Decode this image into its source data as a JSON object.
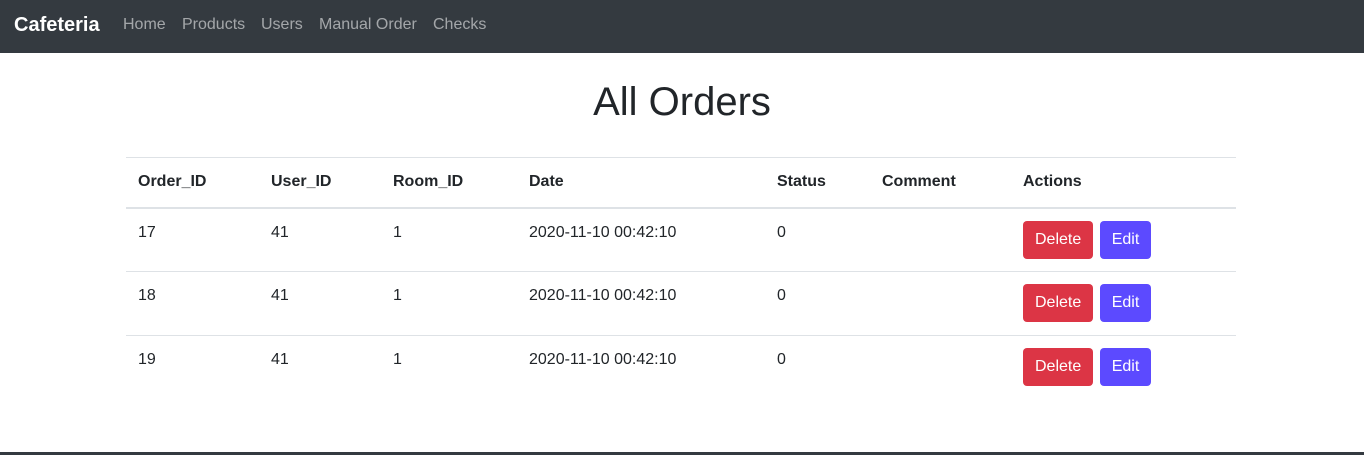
{
  "navbar": {
    "brand": "Cafeteria",
    "links": [
      "Home",
      "Products",
      "Users",
      "Manual Order",
      "Checks"
    ]
  },
  "page": {
    "title": "All Orders"
  },
  "table": {
    "columns": [
      "Order_ID",
      "User_ID",
      "Room_ID",
      "Date",
      "Status",
      "Comment",
      "Actions"
    ],
    "rows": [
      {
        "order_id": "17",
        "user_id": "41",
        "room_id": "1",
        "date": "2020-11-10 00:42:10",
        "status": "0",
        "comment": ""
      },
      {
        "order_id": "18",
        "user_id": "41",
        "room_id": "1",
        "date": "2020-11-10 00:42:10",
        "status": "0",
        "comment": ""
      },
      {
        "order_id": "19",
        "user_id": "41",
        "room_id": "1",
        "date": "2020-11-10 00:42:10",
        "status": "0",
        "comment": ""
      }
    ],
    "delete_label": "Delete",
    "edit_label": "Edit"
  },
  "colors": {
    "navbar_bg": "#343a40",
    "delete_button": "#dc3545",
    "edit_button": "#5c4aff"
  }
}
